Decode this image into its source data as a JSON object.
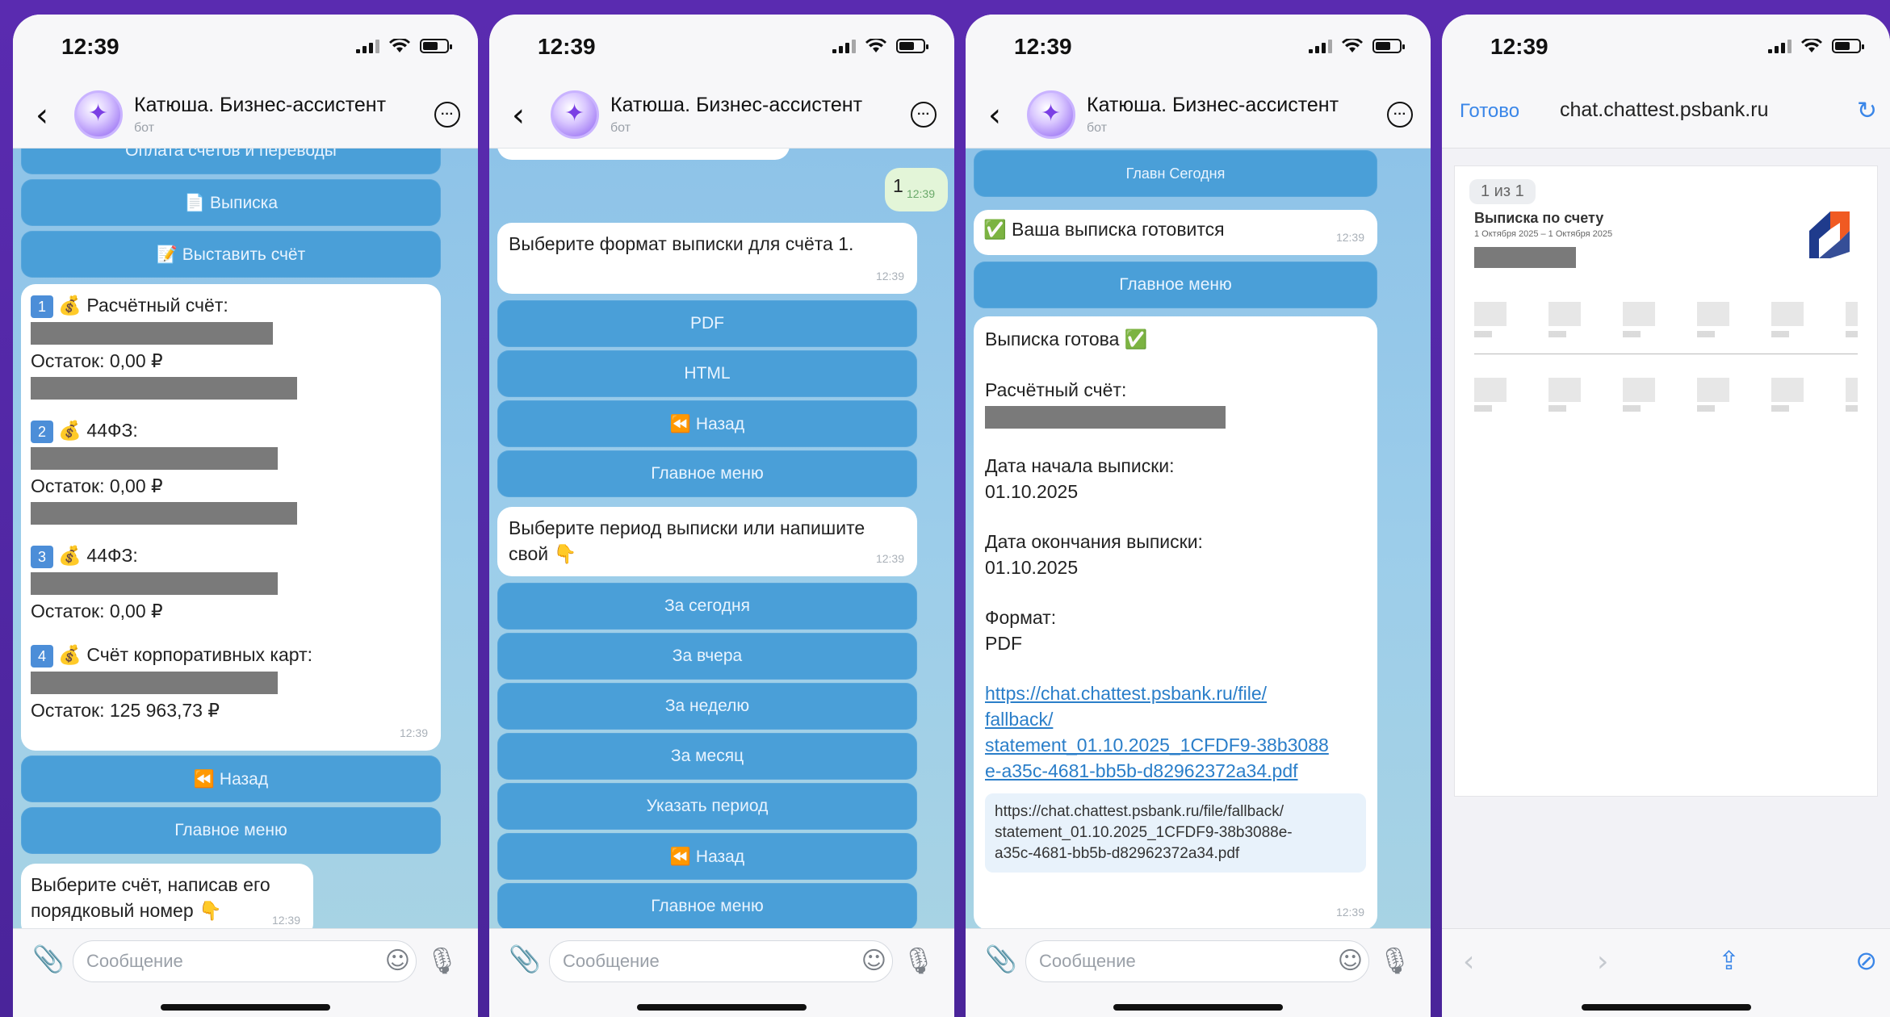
{
  "status": {
    "time": "12:39"
  },
  "chat": {
    "title": "Катюша. Бизнес-ассистент",
    "subtitle": "бот",
    "input_placeholder": "Сообщение"
  },
  "screen1": {
    "top_partial": "Оплата счетов и переводы",
    "btn_statement": "Выписка",
    "btn_invoice": "Выставить счёт",
    "accounts": [
      {
        "num": "1",
        "label": "Расчётный счёт:",
        "balance": "Остаток: 0,00 ₽"
      },
      {
        "num": "2",
        "label": "44ФЗ:",
        "balance": "Остаток: 0,00 ₽"
      },
      {
        "num": "3",
        "label": "44ФЗ:",
        "balance": "Остаток: 0,00 ₽"
      },
      {
        "num": "4",
        "label": "Счёт корпоративных карт:",
        "balance": "Остаток: 125 963,73 ₽"
      }
    ],
    "accounts_time": "12:39",
    "btn_back": "Назад",
    "btn_main": "Главное меню",
    "prompt": "Выберите счёт, написав его порядковый номер",
    "prompt_time": "12:39"
  },
  "screen2": {
    "user_msg": "1",
    "user_time": "12:39",
    "format_prompt": "Выберите формат выписки для счёта 1.",
    "format_time": "12:39",
    "btn_pdf": "PDF",
    "btn_html": "HTML",
    "btn_back": "Назад",
    "btn_main": "Главное меню",
    "period_prompt": "Выберите период выписки или напишите свой",
    "period_time": "12:39",
    "btn_today": "За сегодня",
    "btn_yesterday": "За вчера",
    "btn_week": "За неделю",
    "btn_month": "За месяц",
    "btn_custom": "Указать период",
    "btn_back2": "Назад",
    "btn_main2": "Главное меню"
  },
  "screen3": {
    "btn_today": "Главн Сегодня",
    "preparing": "Ваша выписка готовится",
    "preparing_time": "12:39",
    "btn_main": "Главное меню",
    "ready": "Выписка готова",
    "account_label": "Расчётный счёт:",
    "start_label": "Дата начала выписки:",
    "start_date": "01.10.2025",
    "end_label": "Дата окончания выписки:",
    "end_date": "01.10.2025",
    "format_label": "Формат:",
    "format_value": "PDF",
    "link_l1": "https://chat.chattest.psbank.ru/file/",
    "link_l2": "fallback/",
    "link_l3": "statement_01.10.2025_1CFDF9-38b3088",
    "link_l4": "e-a35c-4681-bb5b-d82962372a34.pdf",
    "preview_l1": "https://chat.chattest.psbank.ru/file/fallback/",
    "preview_l2": "statement_01.10.2025_1CFDF9-38b3088e-",
    "preview_l3": "a35c-4681-bb5b-d82962372a34.pdf",
    "ready_time": "12:39"
  },
  "browser": {
    "done": "Готово",
    "url": "chat.chattest.psbank.ru",
    "page_badge": "1 из 1",
    "pdf_title": "Выписка по счету",
    "pdf_sub": "1 Октября 2025 – 1 Октября 2025"
  }
}
